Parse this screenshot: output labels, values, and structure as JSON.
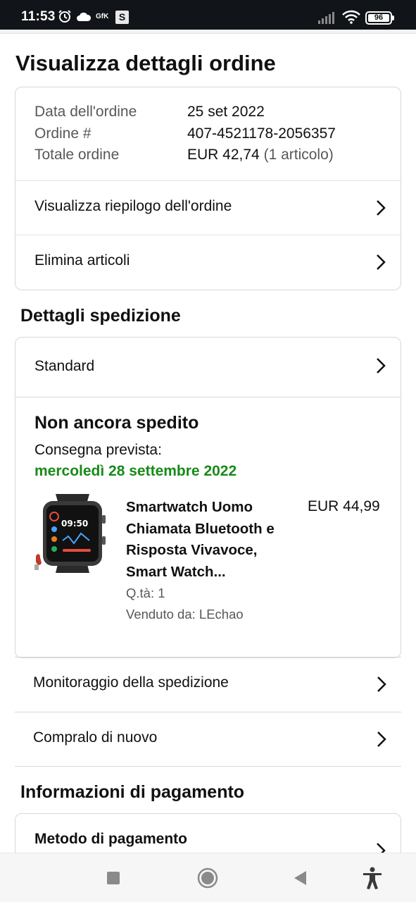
{
  "status_bar": {
    "time": "11:53",
    "gfk": "GfK",
    "s_badge": "S",
    "battery": "96"
  },
  "page": {
    "title": "Visualizza dettagli ordine"
  },
  "order_summary": {
    "date_label": "Data dell'ordine",
    "date_value": "25 set 2022",
    "number_label": "Ordine #",
    "number_value": "407-4521178-2056357",
    "total_label": "Totale ordine",
    "total_value": "EUR 42,74",
    "total_items": "(1 articolo)",
    "summary_link": "Visualizza riepilogo dell'ordine",
    "delete_link": "Elimina articoli"
  },
  "shipping": {
    "section_title": "Dettagli spedizione",
    "method": "Standard",
    "status": "Non ancora spedito",
    "delivery_label": "Consegna prevista:",
    "delivery_date": "mercoledì 28 settembre 2022",
    "delivery_color": "#188a18",
    "product": {
      "title": "Smartwatch Uomo Chiamata Bluetooth e Risposta Vivavoce, Smart Watch...",
      "price": "EUR 44,99",
      "qty": "Q.tà: 1",
      "seller": "Venduto da: LEchao",
      "watch_time": "09:50"
    },
    "track_link": "Monitoraggio della spedizione",
    "buy_again_link": "Compralo di nuovo"
  },
  "payment": {
    "section_title": "Informazioni di pagamento",
    "method_label": "Metodo di pagamento"
  },
  "nav": {
    "icons": [
      "recents-icon",
      "home-icon",
      "back-icon",
      "accessibility-icon"
    ]
  }
}
